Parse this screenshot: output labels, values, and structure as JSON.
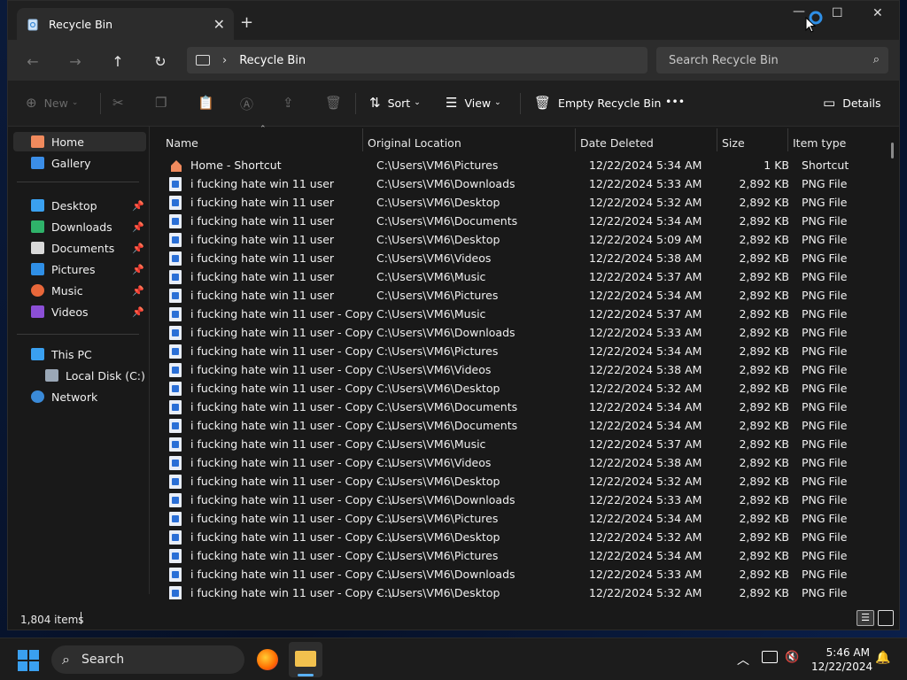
{
  "window": {
    "tab_title": "Recycle Bin",
    "address_location": "Recycle Bin",
    "search_placeholder": "Search Recycle Bin"
  },
  "toolbar": {
    "new_label": "New",
    "sort_label": "Sort",
    "view_label": "View",
    "empty_label": "Empty Recycle Bin",
    "details_label": "Details",
    "more_label": "•••"
  },
  "sidebar": {
    "quick": [
      {
        "label": "Home",
        "icon": "home-icon",
        "color": "#f08a5d"
      },
      {
        "label": "Gallery",
        "icon": "gallery-icon",
        "color": "#3b8ee8"
      }
    ],
    "pinned": [
      {
        "label": "Desktop",
        "icon": "desktop-folder-icon",
        "color": "#3aa0f0"
      },
      {
        "label": "Downloads",
        "icon": "downloads-folder-icon",
        "color": "#2fb36a"
      },
      {
        "label": "Documents",
        "icon": "documents-folder-icon",
        "color": "#d9d9d9"
      },
      {
        "label": "Pictures",
        "icon": "pictures-folder-icon",
        "color": "#2f8fe6"
      },
      {
        "label": "Music",
        "icon": "music-folder-icon",
        "color": "#e8673a"
      },
      {
        "label": "Videos",
        "icon": "videos-folder-icon",
        "color": "#8b4fd6"
      }
    ],
    "this_pc": "This PC",
    "local_disk": "Local Disk (C:)",
    "network": "Network"
  },
  "columns": [
    "Name",
    "Original Location",
    "Date Deleted",
    "Size",
    "Item type"
  ],
  "files": [
    {
      "name": "Home - Shortcut",
      "location": "C:\\Users\\VM6\\Pictures",
      "date": "12/22/2024 5:34 AM",
      "size": "1 KB",
      "type": "Shortcut"
    },
    {
      "name": "i fucking hate win 11 user",
      "location": "C:\\Users\\VM6\\Downloads",
      "date": "12/22/2024 5:33 AM",
      "size": "2,892 KB",
      "type": "PNG File"
    },
    {
      "name": "i fucking hate win 11 user",
      "location": "C:\\Users\\VM6\\Desktop",
      "date": "12/22/2024 5:32 AM",
      "size": "2,892 KB",
      "type": "PNG File"
    },
    {
      "name": "i fucking hate win 11 user",
      "location": "C:\\Users\\VM6\\Documents",
      "date": "12/22/2024 5:34 AM",
      "size": "2,892 KB",
      "type": "PNG File"
    },
    {
      "name": "i fucking hate win 11 user",
      "location": "C:\\Users\\VM6\\Desktop",
      "date": "12/22/2024 5:09 AM",
      "size": "2,892 KB",
      "type": "PNG File"
    },
    {
      "name": "i fucking hate win 11 user",
      "location": "C:\\Users\\VM6\\Videos",
      "date": "12/22/2024 5:38 AM",
      "size": "2,892 KB",
      "type": "PNG File"
    },
    {
      "name": "i fucking hate win 11 user",
      "location": "C:\\Users\\VM6\\Music",
      "date": "12/22/2024 5:37 AM",
      "size": "2,892 KB",
      "type": "PNG File"
    },
    {
      "name": "i fucking hate win 11 user",
      "location": "C:\\Users\\VM6\\Pictures",
      "date": "12/22/2024 5:34 AM",
      "size": "2,892 KB",
      "type": "PNG File"
    },
    {
      "name": "i fucking hate win 11 user - Copy",
      "location": "C:\\Users\\VM6\\Music",
      "date": "12/22/2024 5:37 AM",
      "size": "2,892 KB",
      "type": "PNG File"
    },
    {
      "name": "i fucking hate win 11 user - Copy",
      "location": "C:\\Users\\VM6\\Downloads",
      "date": "12/22/2024 5:33 AM",
      "size": "2,892 KB",
      "type": "PNG File"
    },
    {
      "name": "i fucking hate win 11 user - Copy",
      "location": "C:\\Users\\VM6\\Pictures",
      "date": "12/22/2024 5:34 AM",
      "size": "2,892 KB",
      "type": "PNG File"
    },
    {
      "name": "i fucking hate win 11 user - Copy",
      "location": "C:\\Users\\VM6\\Videos",
      "date": "12/22/2024 5:38 AM",
      "size": "2,892 KB",
      "type": "PNG File"
    },
    {
      "name": "i fucking hate win 11 user - Copy",
      "location": "C:\\Users\\VM6\\Desktop",
      "date": "12/22/2024 5:32 AM",
      "size": "2,892 KB",
      "type": "PNG File"
    },
    {
      "name": "i fucking hate win 11 user - Copy",
      "location": "C:\\Users\\VM6\\Documents",
      "date": "12/22/2024 5:34 AM",
      "size": "2,892 KB",
      "type": "PNG File"
    },
    {
      "name": "i fucking hate win 11 user - Copy - ...",
      "location": "C:\\Users\\VM6\\Documents",
      "date": "12/22/2024 5:34 AM",
      "size": "2,892 KB",
      "type": "PNG File"
    },
    {
      "name": "i fucking hate win 11 user - Copy - ...",
      "location": "C:\\Users\\VM6\\Music",
      "date": "12/22/2024 5:37 AM",
      "size": "2,892 KB",
      "type": "PNG File"
    },
    {
      "name": "i fucking hate win 11 user - Copy - ...",
      "location": "C:\\Users\\VM6\\Videos",
      "date": "12/22/2024 5:38 AM",
      "size": "2,892 KB",
      "type": "PNG File"
    },
    {
      "name": "i fucking hate win 11 user - Copy - ...",
      "location": "C:\\Users\\VM6\\Desktop",
      "date": "12/22/2024 5:32 AM",
      "size": "2,892 KB",
      "type": "PNG File"
    },
    {
      "name": "i fucking hate win 11 user - Copy - ...",
      "location": "C:\\Users\\VM6\\Downloads",
      "date": "12/22/2024 5:33 AM",
      "size": "2,892 KB",
      "type": "PNG File"
    },
    {
      "name": "i fucking hate win 11 user - Copy - ...",
      "location": "C:\\Users\\VM6\\Pictures",
      "date": "12/22/2024 5:34 AM",
      "size": "2,892 KB",
      "type": "PNG File"
    },
    {
      "name": "i fucking hate win 11 user - Copy - ...",
      "location": "C:\\Users\\VM6\\Desktop",
      "date": "12/22/2024 5:32 AM",
      "size": "2,892 KB",
      "type": "PNG File"
    },
    {
      "name": "i fucking hate win 11 user - Copy - ...",
      "location": "C:\\Users\\VM6\\Pictures",
      "date": "12/22/2024 5:34 AM",
      "size": "2,892 KB",
      "type": "PNG File"
    },
    {
      "name": "i fucking hate win 11 user - Copy - ...",
      "location": "C:\\Users\\VM6\\Downloads",
      "date": "12/22/2024 5:33 AM",
      "size": "2,892 KB",
      "type": "PNG File"
    },
    {
      "name": "i fucking hate win 11 user - Copy - ...",
      "location": "C:\\Users\\VM6\\Desktop",
      "date": "12/22/2024 5:32 AM",
      "size": "2,892 KB",
      "type": "PNG File"
    }
  ],
  "status": {
    "item_count": "1,804 items"
  },
  "taskbar": {
    "search_label": "Search",
    "time": "5:46 AM",
    "date": "12/22/2024"
  }
}
